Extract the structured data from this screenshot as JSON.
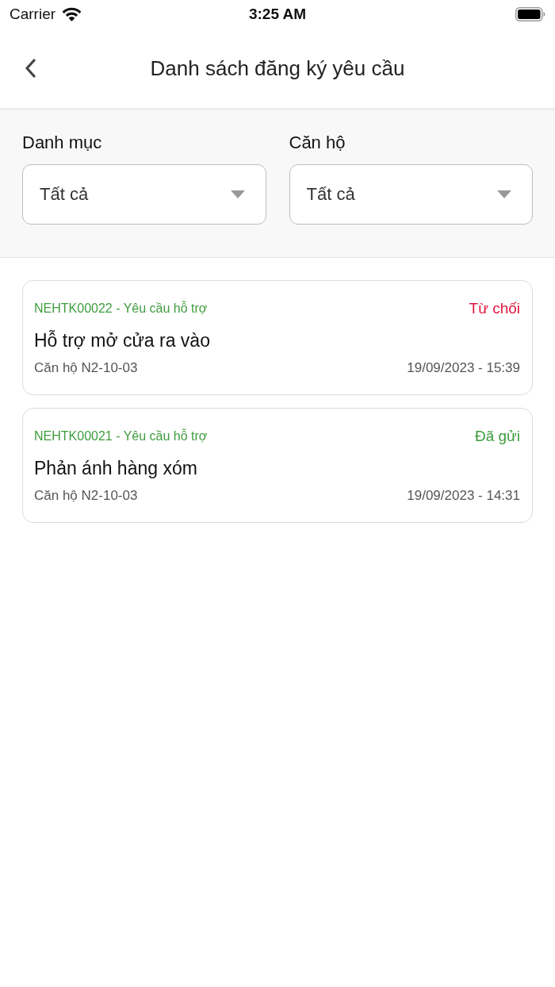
{
  "status_bar": {
    "carrier": "Carrier",
    "time": "3:25 AM"
  },
  "header": {
    "title": "Danh sách đăng ký yêu cầu"
  },
  "filters": [
    {
      "label": "Danh mục",
      "value": "Tất cả"
    },
    {
      "label": "Căn hộ",
      "value": "Tất cả"
    }
  ],
  "requests": [
    {
      "code": "NEHTK00022 - Yêu cầu hỗ trợ",
      "status": "Từ chối",
      "color": "#e3163d",
      "title": "Hỗ trợ mở cửa ra vào",
      "apartment": "Căn hộ N2-10-03",
      "datetime": "19/09/2023 - 15:39"
    },
    {
      "code": "NEHTK00021 - Yêu cầu hỗ trợ",
      "status": "Đã gửi",
      "color": "#3e9c3e",
      "title": "Phản ánh hàng xóm",
      "apartment": "Căn hộ N2-10-03",
      "datetime": "19/09/2023 - 14:31"
    }
  ]
}
